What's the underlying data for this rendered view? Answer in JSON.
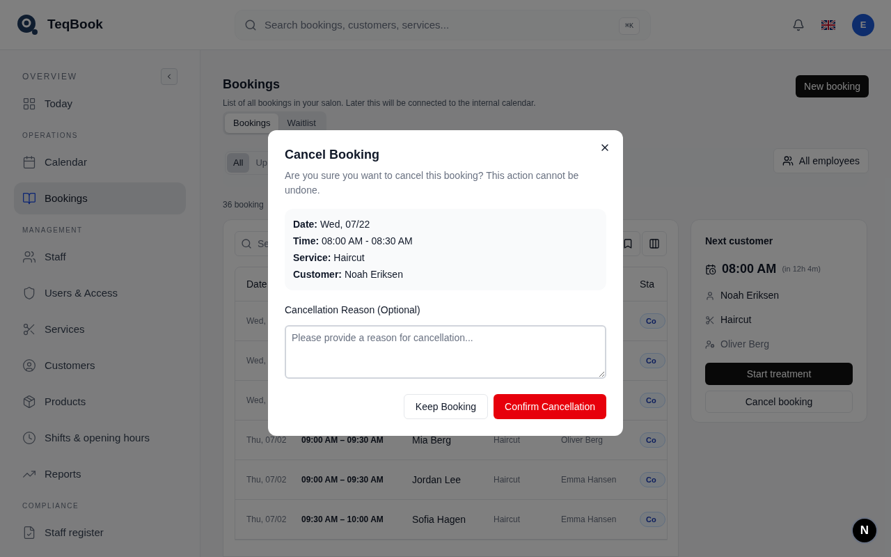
{
  "header": {
    "brand": "TeqBook",
    "search_placeholder": "Search bookings, customers, services...",
    "shortcut": "⌘K",
    "avatar": "E"
  },
  "sidebar": {
    "sections": [
      {
        "title": "OVERVIEW",
        "collapsible": true,
        "items": [
          {
            "label": "Today",
            "selected": false
          }
        ]
      },
      {
        "title": "OPERATIONS",
        "collapsible": false,
        "items": [
          {
            "label": "Calendar",
            "selected": false
          },
          {
            "label": "Bookings",
            "selected": true
          }
        ]
      },
      {
        "title": "MANAGEMENT",
        "collapsible": false,
        "items": [
          {
            "label": "Staff",
            "selected": false
          },
          {
            "label": "Users & Access",
            "selected": false
          },
          {
            "label": "Services",
            "selected": false
          },
          {
            "label": "Customers",
            "selected": false
          },
          {
            "label": "Products",
            "selected": false
          },
          {
            "label": "Shifts & opening hours",
            "selected": false
          },
          {
            "label": "Reports",
            "selected": false
          }
        ]
      },
      {
        "title": "COMPLIANCE",
        "collapsible": false,
        "items": [
          {
            "label": "Staff register",
            "selected": false
          }
        ]
      }
    ]
  },
  "page": {
    "title": "Bookings",
    "subtitle": "List of all bookings in your salon. Later this will be connected to the internal calendar.",
    "new_button": "New booking",
    "tabs": [
      {
        "label": "Bookings",
        "selected": true
      },
      {
        "label": "Waitlist",
        "selected": false
      }
    ],
    "filters": [
      {
        "label": "All",
        "selected": true
      },
      {
        "label": "Up",
        "selected": false
      }
    ],
    "employee_filter": "All employees",
    "count": "36 booking",
    "table": {
      "search_placeholder": "Se",
      "columns": [
        "Date",
        "Sta"
      ],
      "rows": [
        {
          "date": "Wed,",
          "status": "Co"
        },
        {
          "date": "Wed,",
          "status": "Co"
        },
        {
          "date": "Wed,",
          "status": "Co"
        },
        {
          "date": "Thu, 07/02",
          "time": "09:00 AM – 09:30 AM",
          "customer": "Mia Berg",
          "service": "Haircut",
          "employee": "Oliver Berg",
          "status": "Co"
        },
        {
          "date": "Thu, 07/02",
          "time": "09:00 AM – 09:30 AM",
          "customer": "Jordan Lee",
          "service": "Haircut",
          "employee": "Emma Hansen",
          "status": "Co"
        },
        {
          "date": "Thu, 07/02",
          "time": "09:30 AM – 10:00 AM",
          "customer": "Sofia Hagen",
          "service": "Haircut",
          "employee": "Emma Hansen",
          "status": "Co"
        }
      ]
    },
    "next_customer": {
      "title": "Next customer",
      "time": "08:00 AM",
      "eta": "(in 12h 4m)",
      "customer": "Noah Eriksen",
      "service": "Haircut",
      "employee": "Oliver Berg",
      "start_button": "Start treatment",
      "cancel_button": "Cancel booking"
    }
  },
  "dialog": {
    "title": "Cancel Booking",
    "description": "Are you sure you want to cancel this booking? This action cannot be undone.",
    "details": [
      "**Date:** Wed, 07/22",
      "**Time:** 08:00 AM - 08:30 AM",
      "**Service:** Haircut",
      "**Customer:** Noah Eriksen"
    ],
    "reason_label": "Cancellation Reason (Optional)",
    "reason_placeholder": "Please provide a reason for cancellation...",
    "keep_button": "Keep Booking",
    "confirm_button": "Confirm Cancellation"
  },
  "dev_badge": "N"
}
